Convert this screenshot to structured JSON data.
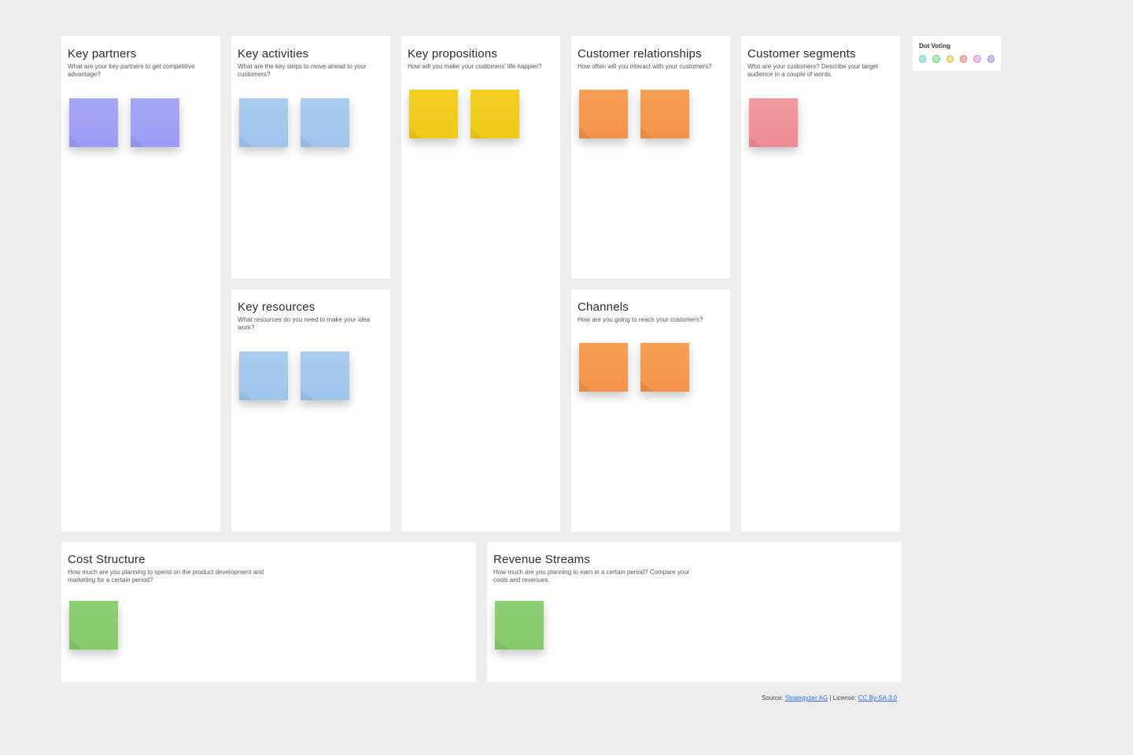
{
  "sections": {
    "key_partners": {
      "title": "Key partners",
      "subtitle": "What are your key partners to get competitive advantage?"
    },
    "key_activities": {
      "title": "Key activities",
      "subtitle": "What are the key steps to move ahead to your customers?"
    },
    "key_resources": {
      "title": "Key resources",
      "subtitle": "What resources do you need to make your idea work?"
    },
    "key_propositions": {
      "title": "Key propositions",
      "subtitle": "How will you make your customers' life happier?"
    },
    "customer_relationships": {
      "title": "Customer relationships",
      "subtitle": "How often will you interact with your customers?"
    },
    "channels": {
      "title": "Channels",
      "subtitle": "How are you going to reach your customers?"
    },
    "customer_segments": {
      "title": "Customer segments",
      "subtitle": "Who are your customers? Describe your target audience in a couple of words."
    },
    "cost_structure": {
      "title": "Cost Structure",
      "subtitle": "How much are you planning to spend on the product development and marketing for a certain period?"
    },
    "revenue_streams": {
      "title": "Revenue Streams",
      "subtitle": "How much are you planning to earn in a certain period? Compare your costs and revenues."
    }
  },
  "notes": {
    "key_partners": [
      {
        "color": "purple"
      },
      {
        "color": "purple"
      }
    ],
    "key_activities": [
      {
        "color": "blue"
      },
      {
        "color": "blue"
      }
    ],
    "key_resources": [
      {
        "color": "blue"
      },
      {
        "color": "blue"
      }
    ],
    "key_propositions": [
      {
        "color": "yellow"
      },
      {
        "color": "yellow"
      }
    ],
    "customer_relationships": [
      {
        "color": "orange"
      },
      {
        "color": "orange"
      }
    ],
    "channels": [
      {
        "color": "orange"
      },
      {
        "color": "orange"
      }
    ],
    "customer_segments": [
      {
        "color": "pink"
      }
    ],
    "cost_structure": [
      {
        "color": "green"
      }
    ],
    "revenue_streams": [
      {
        "color": "green"
      }
    ]
  },
  "dot_voting": {
    "title": "Dot Voting",
    "colors": [
      "cyan",
      "green",
      "yellow",
      "red",
      "pink",
      "purple"
    ]
  },
  "footer": {
    "source_label": "Source: ",
    "source_link": "Strategyzer AG",
    "sep": " | License: ",
    "license_link": "CC By-SA 3.0"
  }
}
